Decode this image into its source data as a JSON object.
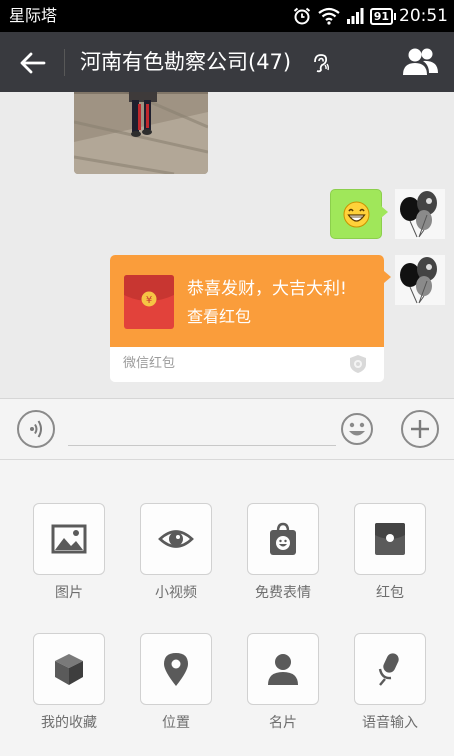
{
  "status_bar": {
    "carrier": "星际塔",
    "battery": "91",
    "time": "20:51",
    "icons": [
      "alarm-icon",
      "wifi-icon",
      "signal-icon",
      "battery-icon"
    ]
  },
  "title_bar": {
    "title": "河南有色勘察公司(47)",
    "back_icon": "arrow-left-icon",
    "mute_icon": "ear-mute-icon",
    "members_icon": "people-icon"
  },
  "chat": {
    "messages": [
      {
        "type": "image",
        "from": "other"
      },
      {
        "type": "sticker",
        "from": "self",
        "sticker": "grinning-face"
      },
      {
        "type": "red_packet",
        "from": "self",
        "greeting": "恭喜发财，大吉大利!",
        "action": "查看红包",
        "source": "微信红包"
      }
    ]
  },
  "input_bar": {
    "voice_icon": "voice-icon",
    "emoji_icon": "emoji-icon",
    "plus_icon": "plus-icon",
    "value": ""
  },
  "panel": {
    "items": [
      {
        "label": "图片",
        "icon": "picture-icon"
      },
      {
        "label": "小视频",
        "icon": "eye-icon"
      },
      {
        "label": "免费表情",
        "icon": "sticker-bag-icon"
      },
      {
        "label": "红包",
        "icon": "red-packet-icon"
      },
      {
        "label": "我的收藏",
        "icon": "cube-icon"
      },
      {
        "label": "位置",
        "icon": "location-pin-icon"
      },
      {
        "label": "名片",
        "icon": "person-icon"
      },
      {
        "label": "语音输入",
        "icon": "microphone-icon"
      }
    ]
  },
  "colors": {
    "title_bar": "#393a3f",
    "red_packet": "#fa9d3b",
    "sticker_bubble": "#a0e75a",
    "icon_gray": "#5a5a5a"
  }
}
